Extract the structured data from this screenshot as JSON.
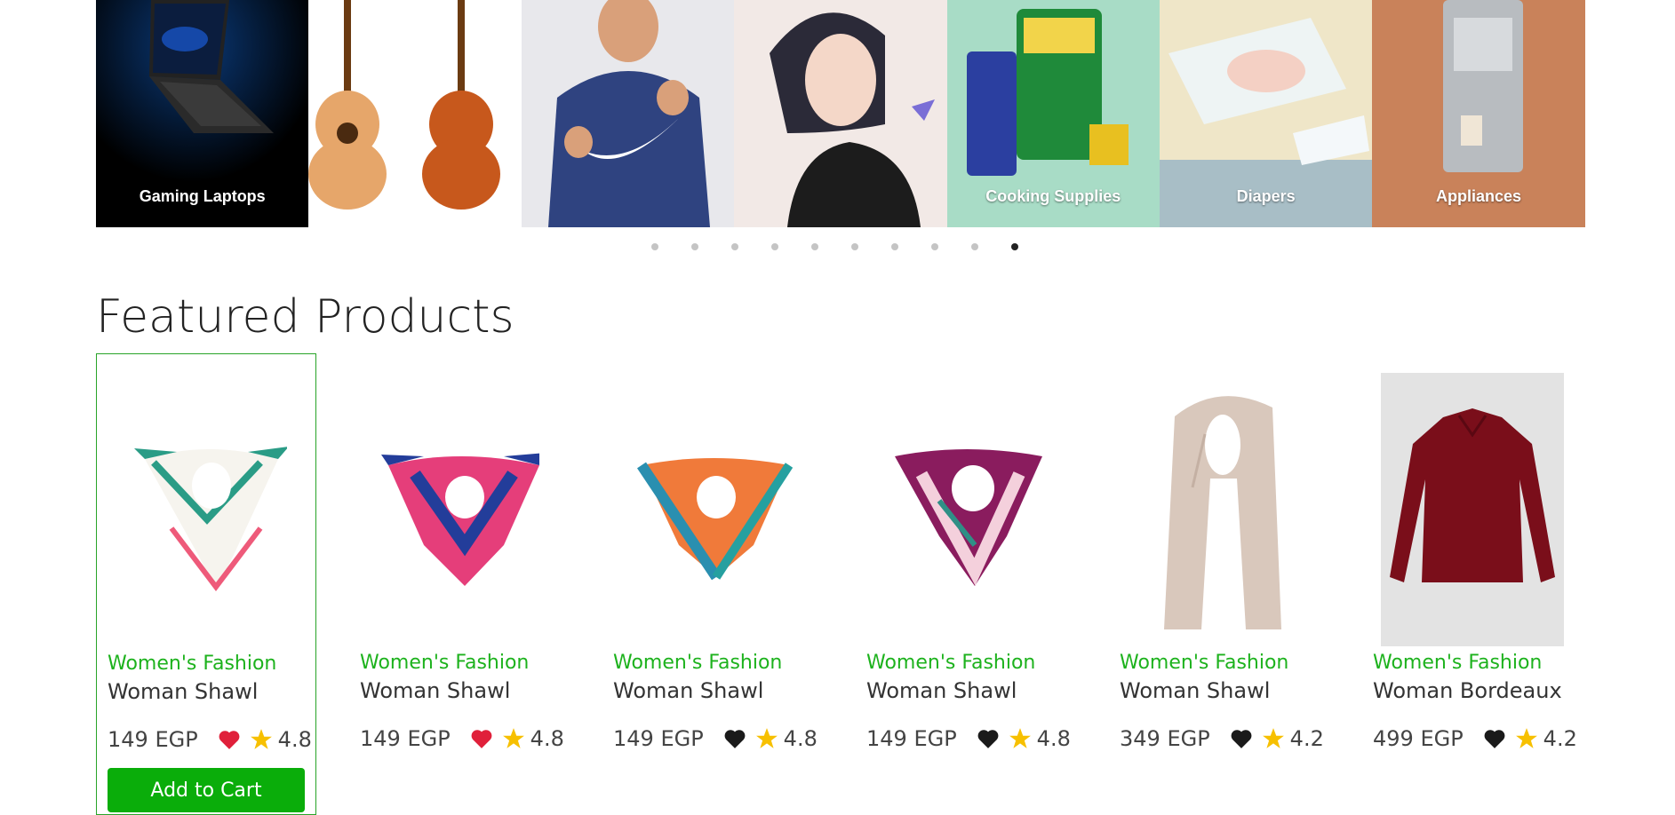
{
  "carousel": {
    "slides": [
      {
        "label": "Gaming Laptops",
        "image": "gaming-laptop-image"
      },
      {
        "label": "",
        "image": "acoustic-guitars-image"
      },
      {
        "label": "",
        "image": "nike-hoodie-man-image"
      },
      {
        "label": "",
        "image": "anime-girl-image"
      },
      {
        "label": "Cooking Supplies",
        "image": "cooking-supplies-image"
      },
      {
        "label": "Diapers",
        "image": "diapers-image"
      },
      {
        "label": "Appliances",
        "image": "coffee-machine-image"
      }
    ],
    "dots_count": 10,
    "active_dot": 9
  },
  "section": {
    "title": "Featured Products"
  },
  "products": [
    {
      "category": "Women's Fashion",
      "name": "Woman Shawl",
      "price": "149 EGP",
      "rating": "4.8",
      "favorite": true,
      "heart_color": "#e0203a",
      "selected": true,
      "add_label": "Add to Cart",
      "image": "scarf-white-green-image"
    },
    {
      "category": "Women's Fashion",
      "name": "Woman Shawl",
      "price": "149 EGP",
      "rating": "4.8",
      "favorite": true,
      "heart_color": "#e0203a",
      "selected": false,
      "image": "scarf-pink-blue-image"
    },
    {
      "category": "Women's Fashion",
      "name": "Woman Shawl",
      "price": "149 EGP",
      "rating": "4.8",
      "favorite": false,
      "heart_color": "#1a1a1a",
      "selected": false,
      "image": "scarf-orange-teal-image"
    },
    {
      "category": "Women's Fashion",
      "name": "Woman Shawl",
      "price": "149 EGP",
      "rating": "4.8",
      "favorite": false,
      "heart_color": "#1a1a1a",
      "selected": false,
      "image": "scarf-purple-image"
    },
    {
      "category": "Women's Fashion",
      "name": "Woman Shawl",
      "price": "349 EGP",
      "rating": "4.2",
      "favorite": false,
      "heart_color": "#1a1a1a",
      "selected": false,
      "image": "scarf-beige-image"
    },
    {
      "category": "Women's Fashion",
      "name": "Woman Bordeaux",
      "price": "499 EGP",
      "rating": "4.2",
      "favorite": false,
      "heart_color": "#1a1a1a",
      "selected": false,
      "image": "bordeaux-shirt-image"
    }
  ],
  "colors": {
    "accent": "#1db21d",
    "button": "#0aad0a",
    "star": "#f7c000",
    "heart_active": "#e0203a"
  }
}
